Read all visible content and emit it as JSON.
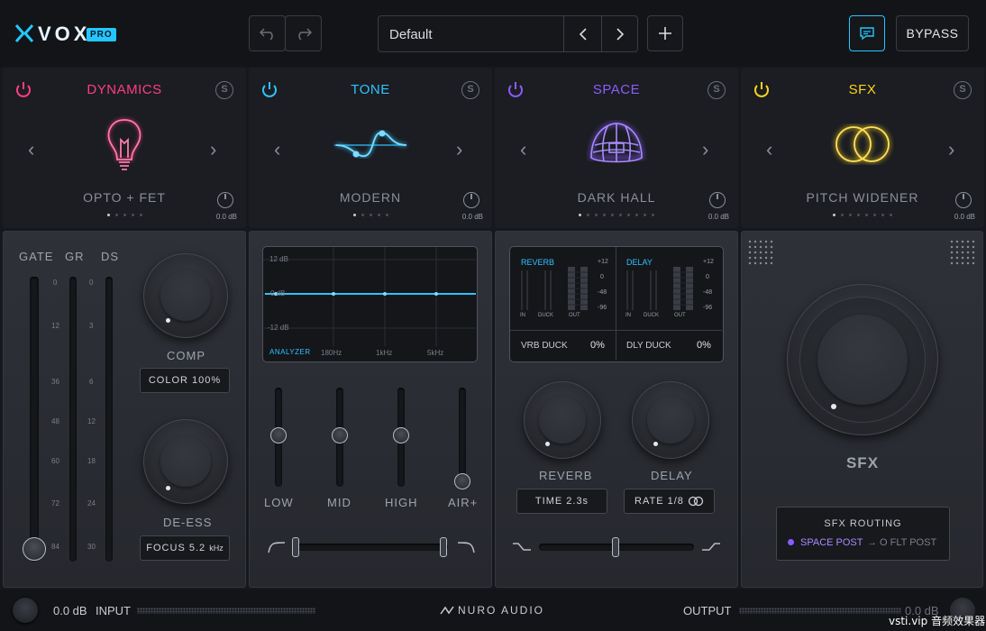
{
  "header": {
    "logo_text": "VOX",
    "logo_badge": "PRO",
    "preset_name": "Default",
    "bypass_label": "BYPASS"
  },
  "modules": [
    {
      "title": "DYNAMICS",
      "preset": "OPTO + FET",
      "db": "0.0 dB",
      "color": "#ff3d7f",
      "icon": "lightbulb-icon"
    },
    {
      "title": "TONE",
      "preset": "MODERN",
      "db": "0.0 dB",
      "color": "#2fc3ff",
      "icon": "eq-curve-icon"
    },
    {
      "title": "SPACE",
      "preset": "DARK HALL",
      "db": "0.0 dB",
      "color": "#8a5cff",
      "icon": "dome-icon"
    },
    {
      "title": "SFX",
      "preset": "PITCH WIDENER",
      "db": "0.0 dB",
      "color": "#ffd21e",
      "icon": "overlap-circles-icon"
    }
  ],
  "dynamics": {
    "meter_labels": [
      "GATE",
      "GR",
      "DS"
    ],
    "gate_ticks": [
      "0",
      "12",
      "36",
      "48",
      "60",
      "72",
      "84"
    ],
    "gr_ticks": [
      "0",
      "3",
      "6",
      "12",
      "18",
      "24",
      "30"
    ],
    "comp_label": "COMP",
    "color_label": "COLOR",
    "color_value": "100%",
    "deess_label": "DE-ESS",
    "focus_label": "FOCUS",
    "focus_value": "5.2",
    "focus_unit": "kHz"
  },
  "tone": {
    "db_labels": [
      "12 dB",
      "0 dB",
      "-12 dB"
    ],
    "analyzer_label": "ANALYZER",
    "freq_labels": [
      "180Hz",
      "1kHz",
      "5kHz"
    ],
    "band_labels": [
      "LOW",
      "MID",
      "HIGH",
      "AIR+"
    ]
  },
  "space": {
    "reverb_title": "REVERB",
    "delay_title": "DELAY",
    "meter_sub": [
      "IN",
      "DUCK",
      "OUT"
    ],
    "scale": [
      "+12",
      "0",
      "-48",
      "-96"
    ],
    "vrb_duck_label": "VRB DUCK",
    "vrb_duck_value": "0%",
    "dly_duck_label": "DLY DUCK",
    "dly_duck_value": "0%",
    "reverb_label": "REVERB",
    "delay_label": "DELAY",
    "time_label": "TIME",
    "time_value": "2.3s",
    "rate_label": "RATE",
    "rate_value": "1/8"
  },
  "sfx": {
    "knob_label": "SFX",
    "routing_title": "SFX ROUTING",
    "routing_active": "SPACE POST",
    "routing_arrow": "→",
    "routing_inactive": "O FLT POST"
  },
  "footer": {
    "input_db": "0.0 dB",
    "input_label": "INPUT",
    "brand": "NURO AUDIO",
    "output_label": "OUTPUT",
    "output_db": "0.0 dB",
    "watermark": "vsti.vip 音频效果器"
  }
}
